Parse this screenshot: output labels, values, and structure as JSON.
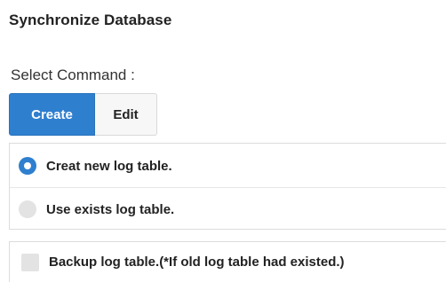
{
  "panel": {
    "title": "Synchronize Database"
  },
  "command": {
    "label": "Select Command :",
    "buttons": [
      {
        "label": "Create",
        "selected": true
      },
      {
        "label": "Edit",
        "selected": false
      }
    ]
  },
  "log_table_options": [
    {
      "label": "Creat new log table.",
      "checked": true
    },
    {
      "label": "Use exists log table.",
      "checked": false
    }
  ],
  "backup": {
    "label": "Backup log table.(*If old log table had existed.)",
    "checked": false
  },
  "colors": {
    "accent": "#2f7fcf",
    "unchecked": "#e3e3e3",
    "border": "#dcdcdc"
  }
}
